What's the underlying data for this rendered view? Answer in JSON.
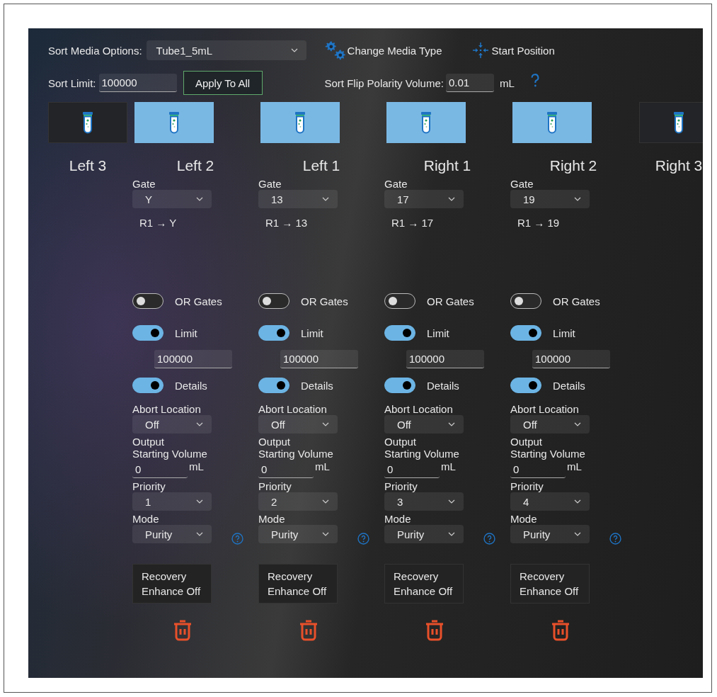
{
  "header": {
    "media_label": "Sort Media Options:",
    "media_value": "Tube1_5mL",
    "change_media": "Change Media Type",
    "start_position": "Start Position",
    "limit_label": "Sort Limit:",
    "limit_value": "100000",
    "apply_button": "Apply To All",
    "flip_label": "Sort Flip Polarity Volume:",
    "flip_value": "0.01",
    "flip_unit": "mL"
  },
  "positions": [
    {
      "label": "Left 3",
      "selected": false
    },
    {
      "label": "Left 2",
      "selected": true,
      "settings": {
        "gate_label": "Gate",
        "gate": "Y",
        "route": "R1 → Y",
        "or_gates": {
          "label": "OR Gates",
          "on": false
        },
        "limit": {
          "label": "Limit",
          "on": true,
          "value": "100000"
        },
        "details": {
          "label": "Details",
          "on": true
        },
        "abort_label": "Abort Location",
        "abort": "Off",
        "output_label": "Output",
        "volume_label": "Starting Volume",
        "volume": "0",
        "volume_unit": "mL",
        "priority_label": "Priority",
        "priority": "1",
        "mode_label": "Mode",
        "mode": "Purity",
        "recovery": "Recovery Enhance Off"
      }
    },
    {
      "label": "Left 1",
      "selected": true,
      "settings": {
        "gate_label": "Gate",
        "gate": "13",
        "route": "R1 → 13",
        "or_gates": {
          "label": "OR Gates",
          "on": false
        },
        "limit": {
          "label": "Limit",
          "on": true,
          "value": "100000"
        },
        "details": {
          "label": "Details",
          "on": true
        },
        "abort_label": "Abort Location",
        "abort": "Off",
        "output_label": "Output",
        "volume_label": "Starting Volume",
        "volume": "0",
        "volume_unit": "mL",
        "priority_label": "Priority",
        "priority": "2",
        "mode_label": "Mode",
        "mode": "Purity",
        "recovery": "Recovery Enhance Off"
      }
    },
    {
      "label": "Right 1",
      "selected": true,
      "settings": {
        "gate_label": "Gate",
        "gate": "17",
        "route": "R1 → 17",
        "or_gates": {
          "label": "OR Gates",
          "on": false
        },
        "limit": {
          "label": "Limit",
          "on": true,
          "value": "100000"
        },
        "details": {
          "label": "Details",
          "on": true
        },
        "abort_label": "Abort Location",
        "abort": "Off",
        "output_label": "Output",
        "volume_label": "Starting Volume",
        "volume": "0",
        "volume_unit": "mL",
        "priority_label": "Priority",
        "priority": "3",
        "mode_label": "Mode",
        "mode": "Purity",
        "recovery": "Recovery Enhance Off"
      }
    },
    {
      "label": "Right 2",
      "selected": true,
      "settings": {
        "gate_label": "Gate",
        "gate": "19",
        "route": "R1 → 19",
        "or_gates": {
          "label": "OR Gates",
          "on": false
        },
        "limit": {
          "label": "Limit",
          "on": true,
          "value": "100000"
        },
        "details": {
          "label": "Details",
          "on": true
        },
        "abort_label": "Abort Location",
        "abort": "Off",
        "output_label": "Output",
        "volume_label": "Starting Volume",
        "volume": "0",
        "volume_unit": "mL",
        "priority_label": "Priority",
        "priority": "4",
        "mode_label": "Mode",
        "mode": "Purity",
        "recovery": "Recovery Enhance Off"
      }
    },
    {
      "label": "Right 3",
      "selected": false
    }
  ]
}
